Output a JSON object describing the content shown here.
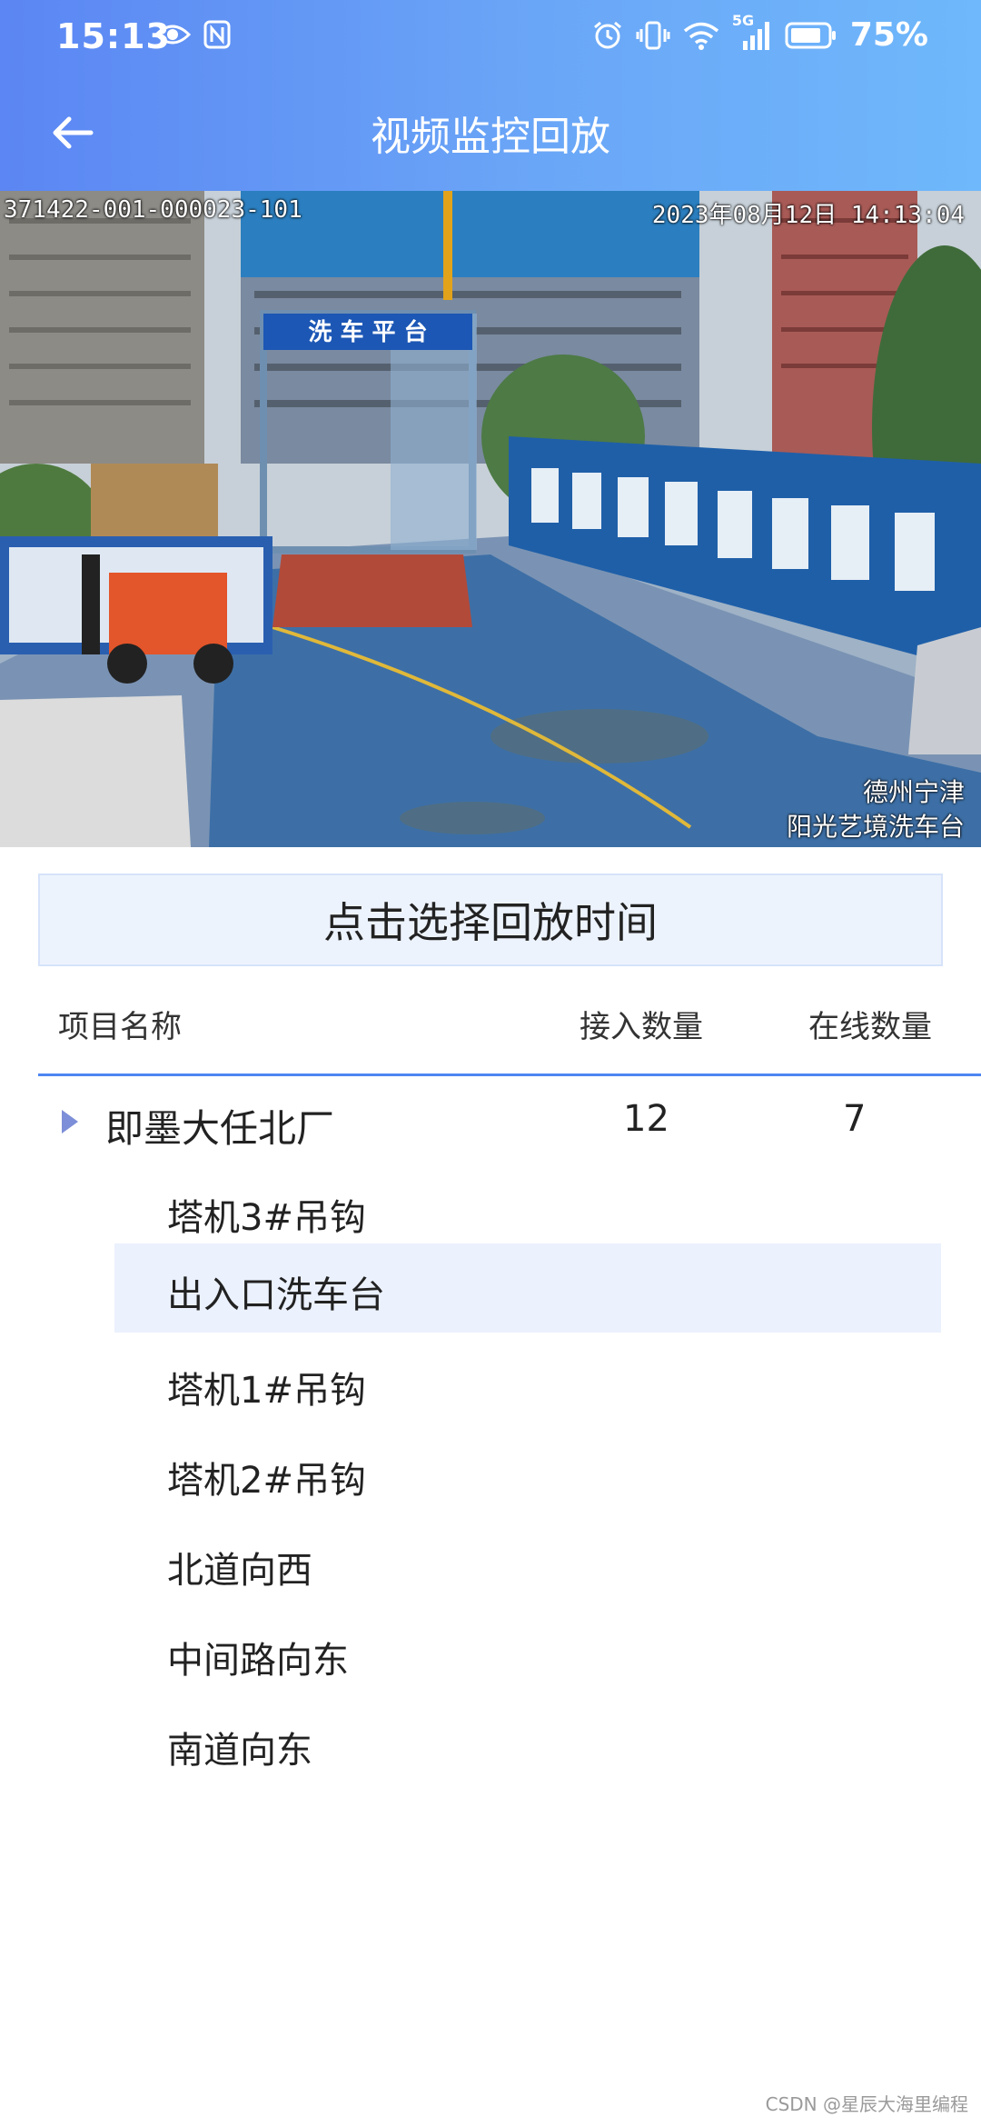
{
  "status_bar": {
    "time": "15:13",
    "battery": "75%",
    "network_badge": "5G",
    "icons": [
      "eye-icon",
      "nfc-icon",
      "alarm-icon",
      "vibrate-icon",
      "wifi-icon",
      "signal-icon",
      "battery-icon"
    ]
  },
  "nav": {
    "title": "视频监控回放",
    "back_icon": "back-arrow-icon"
  },
  "video": {
    "osd_id": "371422-001-000023-101",
    "osd_time": "2023年08月12日 14:13:04",
    "caption_line1": "德州宁津",
    "caption_line2": "阳光艺境洗车台",
    "sign_text": "洗 车 平 台"
  },
  "time_button": {
    "label": "点击选择回放时间"
  },
  "table": {
    "headers": {
      "name": "项目名称",
      "access": "接入数量",
      "online": "在线数量"
    },
    "project": {
      "name": "即墨大任北厂",
      "access": "12",
      "online": "7"
    },
    "cameras": [
      {
        "label": "塔机3#吊钩",
        "selected": false
      },
      {
        "label": "出入口洗车台",
        "selected": true
      },
      {
        "label": "塔机1#吊钩",
        "selected": false
      },
      {
        "label": "塔机2#吊钩",
        "selected": false
      },
      {
        "label": "北道向西",
        "selected": false
      },
      {
        "label": "中间路向东",
        "selected": false
      },
      {
        "label": "南道向东",
        "selected": false
      }
    ]
  },
  "watermark": "CSDN @星辰大海里编程",
  "colors": {
    "header_gradient_start": "#5b86f3",
    "header_gradient_end": "#6fb8fb",
    "accent_line": "#4d86f2",
    "selected_row_bg": "#ebf1fd",
    "time_button_bg": "#edf3fd"
  }
}
